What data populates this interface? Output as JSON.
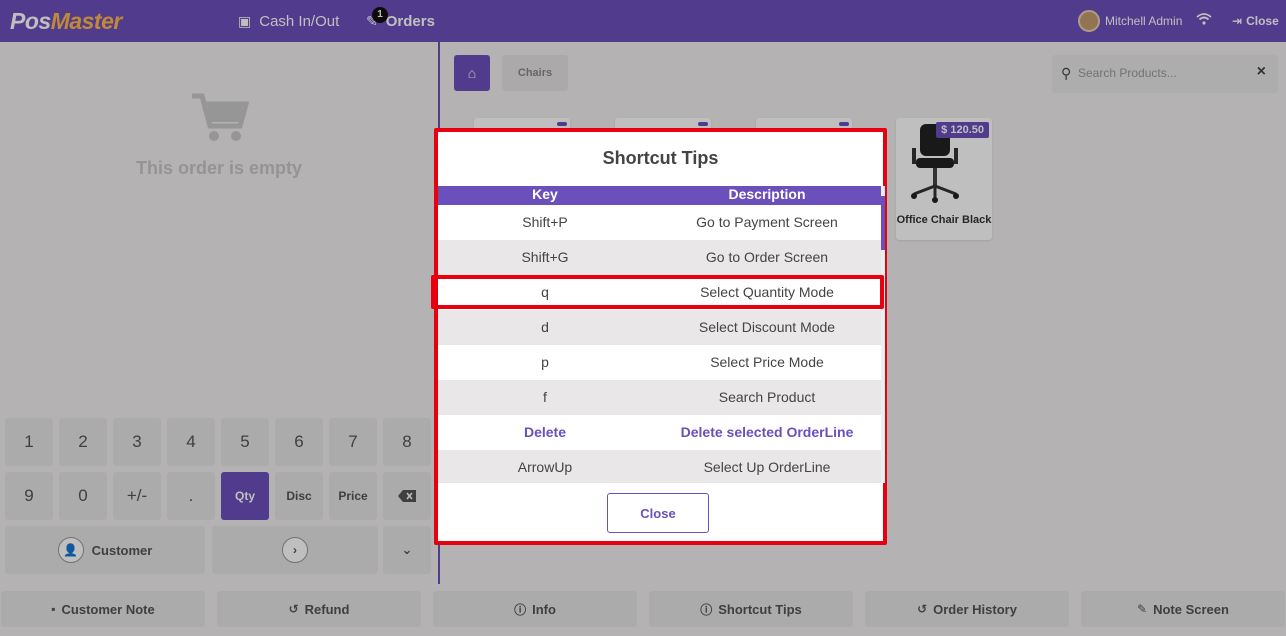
{
  "topbar": {
    "brand": "PoS",
    "cash": "Cash In/Out",
    "orders": "Orders",
    "order_count": "1",
    "user": "Mitchell Admin",
    "close": "Close"
  },
  "order": {
    "empty_text": "This order is empty"
  },
  "numpad": {
    "row1": [
      "1",
      "2",
      "3",
      "4",
      "5",
      "6",
      "7",
      "8"
    ],
    "row2": [
      "9",
      "0",
      "+/-",
      ".",
      "Qty",
      "Disc",
      "Price"
    ],
    "customer": "Customer"
  },
  "products_pane": {
    "category": "Chairs",
    "search_placeholder": "Search Products...",
    "products": [
      {
        "name": "",
        "price": ""
      },
      {
        "name": "",
        "price": ""
      },
      {
        "name": "",
        "price": ""
      },
      {
        "name": "Office Chair Black",
        "price": "$ 120.50"
      }
    ]
  },
  "actions": [
    "Customer Note",
    "Refund",
    "Info",
    "Shortcut Tips",
    "Order History",
    "Note Screen"
  ],
  "modal": {
    "title": "Shortcut Tips",
    "headers": {
      "key": "Key",
      "description": "Description"
    },
    "rows": [
      {
        "key": "Shift+P",
        "description": "Go to Payment Screen"
      },
      {
        "key": "Shift+G",
        "description": "Go to Order Screen"
      },
      {
        "key": "q",
        "description": "Select Quantity Mode"
      },
      {
        "key": "d",
        "description": "Select Discount Mode"
      },
      {
        "key": "p",
        "description": "Select Price Mode"
      },
      {
        "key": "f",
        "description": "Search Product"
      },
      {
        "key": "Delete",
        "description": "Delete selected OrderLine"
      },
      {
        "key": "ArrowUp",
        "description": "Select Up OrderLine"
      }
    ],
    "close_label": "Close"
  },
  "colors": {
    "accent": "#6b4fbb",
    "highlight": "#e8000f"
  }
}
